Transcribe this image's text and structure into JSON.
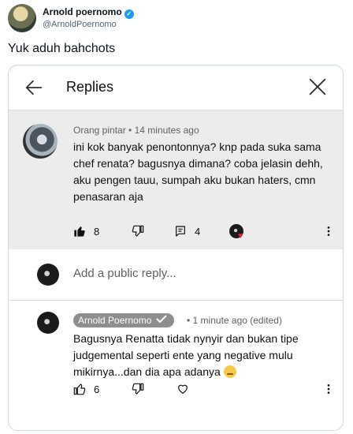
{
  "tweet": {
    "author_name": "Arnold poernomo",
    "author_handle": "@ArnoldPoernomo",
    "text": "Yuk aduh bahchots",
    "accent_color": "#1d9bf0"
  },
  "replies_panel": {
    "title": "Replies",
    "back_icon": "arrow-left-icon",
    "close_icon": "close-icon",
    "parent_comment": {
      "author": "Orang pintar",
      "time": "14 minutes ago",
      "text": "ini kok banyak penontonnya? knp pada suka sama chef renata? bagusnya dimana? coba jelasin dehh, aku pengen tauu, sumpah aku bukan haters, cmn penasaran aja",
      "likes": "8",
      "replies": "4"
    },
    "reply_input": {
      "placeholder": "Add a public reply..."
    },
    "reply_comment": {
      "author": "Arnold Poernomo",
      "time": "1 minute ago (edited)",
      "text": "Bagusnya Renatta tidak nynyir dan bukan tipe judgemental seperti ente yang negative mulu mikirnya...dan dia apa adanya",
      "emoji": "relieved-face-emoji",
      "likes": "6"
    }
  }
}
